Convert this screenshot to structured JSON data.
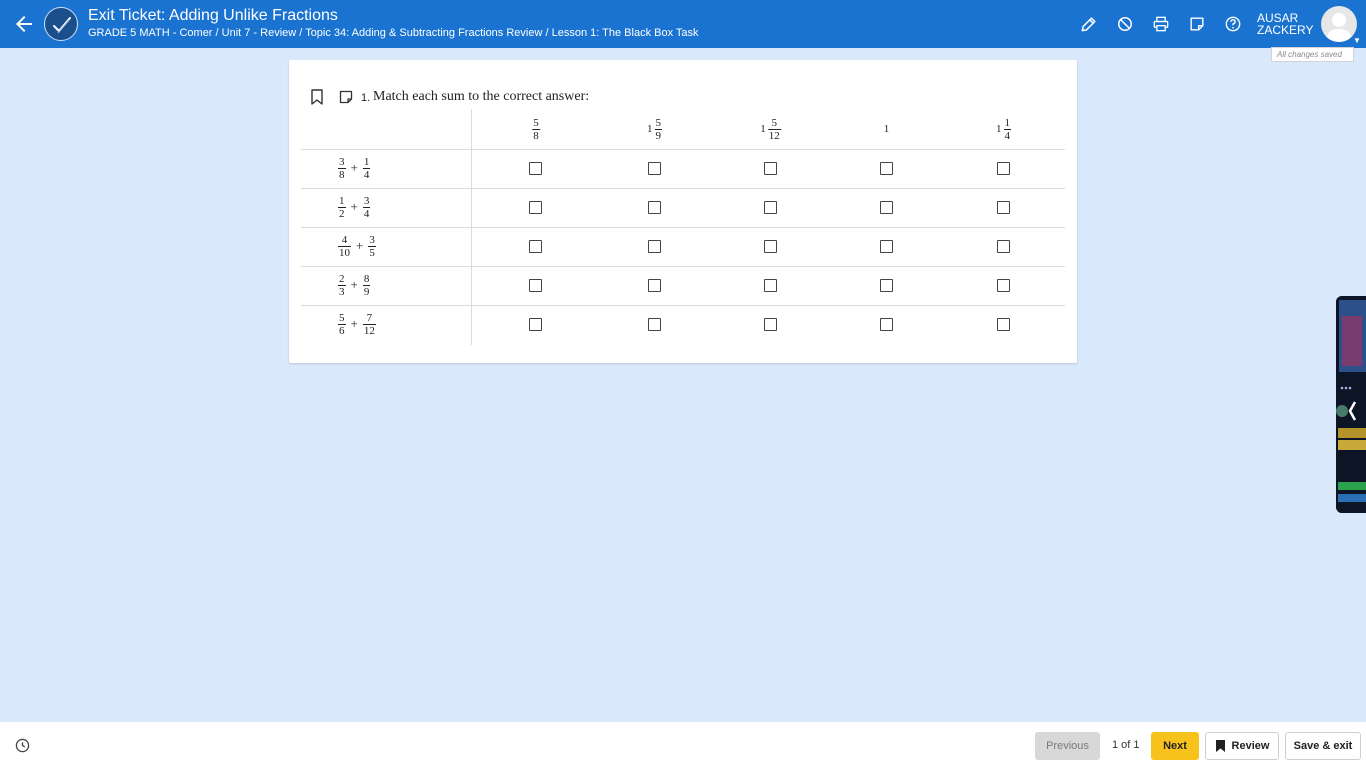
{
  "header": {
    "title": "Exit Ticket: Adding Unlike Fractions",
    "breadcrumb": "GRADE 5 MATH - Comer / Unit 7 - Review / Topic 34: Adding & Subtracting Fractions Review / Lesson 1: The Black Box Task",
    "user_first": "AUSAR",
    "user_last": "ZACKERY",
    "save_status": "All changes saved",
    "tools": [
      "pencil-icon",
      "ban-icon",
      "print-icon",
      "note-icon",
      "help-icon"
    ]
  },
  "question": {
    "number": "1.",
    "prompt": "Match each sum to the correct answer:",
    "columns": [
      {
        "whole": "",
        "num": "5",
        "den": "8"
      },
      {
        "whole": "1",
        "num": "5",
        "den": "9"
      },
      {
        "whole": "1",
        "num": "5",
        "den": "12"
      },
      {
        "whole": "1",
        "num": "",
        "den": ""
      },
      {
        "whole": "1",
        "num": "1",
        "den": "4"
      }
    ],
    "rows": [
      {
        "a_num": "3",
        "a_den": "8",
        "op": "+",
        "b_num": "1",
        "b_den": "4"
      },
      {
        "a_num": "1",
        "a_den": "2",
        "op": "+",
        "b_num": "3",
        "b_den": "4"
      },
      {
        "a_num": "4",
        "a_den": "10",
        "op": "+",
        "b_num": "3",
        "b_den": "5"
      },
      {
        "a_num": "2",
        "a_den": "3",
        "op": "+",
        "b_num": "8",
        "b_den": "9"
      },
      {
        "a_num": "5",
        "a_den": "6",
        "op": "+",
        "b_num": "7",
        "b_den": "12"
      }
    ]
  },
  "footer": {
    "previous": "Previous",
    "pager": "1 of 1",
    "next": "Next",
    "review": "Review",
    "save_exit": "Save & exit"
  },
  "colors": {
    "header_bg": "#1a73d1",
    "page_bg": "#d9e8fa",
    "next_bg": "#f7c21b"
  }
}
